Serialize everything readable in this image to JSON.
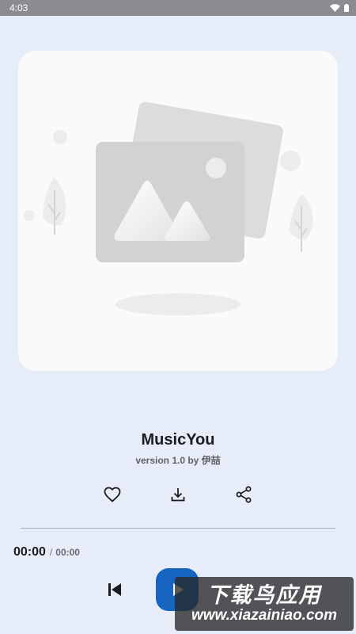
{
  "status_bar": {
    "time": "4:03",
    "wifi_icon": "wifi-icon",
    "battery_icon": "battery-icon"
  },
  "album_art": {
    "icon": "image-placeholder-icon"
  },
  "track": {
    "title": "MusicYou",
    "subtitle": "version 1.0 by 伊喆"
  },
  "actions": [
    {
      "name": "favorite",
      "icon": "heart-icon"
    },
    {
      "name": "download",
      "icon": "download-icon"
    },
    {
      "name": "share",
      "icon": "share-icon"
    }
  ],
  "progress": {
    "current": "00:00",
    "separator": "/",
    "total": "00:00",
    "fraction": 0
  },
  "controls": {
    "previous_icon": "skip-previous-icon",
    "play_icon": "play-icon"
  },
  "watermark": {
    "main": "下载鸟应用",
    "url": "www.xiazainiao.com"
  },
  "colors": {
    "background": "#e6edf8",
    "accent": "#1565c0",
    "card": "#fafafa"
  }
}
